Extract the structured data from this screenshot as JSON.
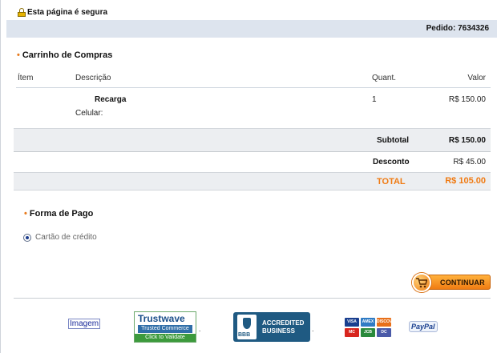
{
  "secure": {
    "text": "Esta página é segura",
    "icon": "lock-icon"
  },
  "order": {
    "label": "Pedido: 7634326"
  },
  "cart": {
    "title": "Carrinho de Compras",
    "columns": {
      "item": "Ítem",
      "description": "Descrição",
      "quantity": "Quant.",
      "value": "Valor"
    },
    "rows": [
      {
        "product": "Recarga",
        "phone_label": "Celular:",
        "quantity": "1",
        "value": "R$ 150.00"
      }
    ],
    "subtotal_label": "Subtotal",
    "subtotal_value": "R$ 150.00",
    "discount_label": "Desconto",
    "discount_value": "R$ 45.00",
    "total_label": "TOTAL",
    "total_value": "R$ 105.00"
  },
  "payment": {
    "title": "Forma de Pago",
    "option_label": "Cartão de crédito",
    "option_selected": true
  },
  "actions": {
    "continue_label": "CONTINUAR"
  },
  "footer": {
    "image_link": "Imagem",
    "trustwave": {
      "brand": "Trustwave",
      "subtitle": "Trusted Commerce",
      "cta": "Click to Validate"
    },
    "bbb": {
      "mark": "BBB",
      "line1": "ACCREDITED",
      "line2": "BUSINESS"
    },
    "cards": [
      {
        "name": "VISA",
        "color": "#1a3f8f"
      },
      {
        "name": "AMEX",
        "color": "#2f7bc4"
      },
      {
        "name": "DISCOVER",
        "color": "#e8701a"
      },
      {
        "name": "MC",
        "color": "#d8261e"
      },
      {
        "name": "JCB",
        "color": "#2a8a3c"
      },
      {
        "name": "DC",
        "color": "#4a5aa8"
      }
    ],
    "paypal": "PayPal"
  },
  "colors": {
    "accent": "#f07a12",
    "header_bar": "#dde4ee",
    "link": "#1a2a9a"
  }
}
